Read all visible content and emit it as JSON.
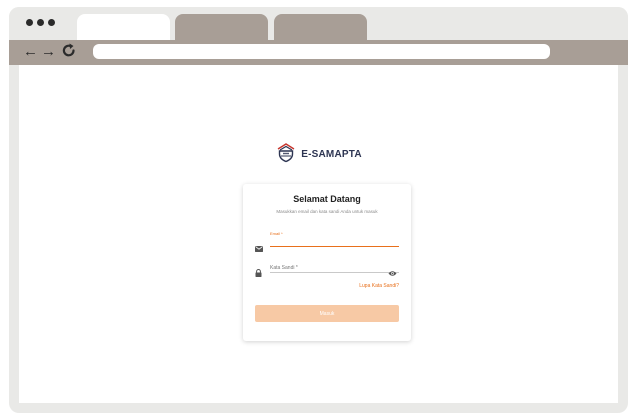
{
  "app": {
    "logo_text": "E-SAMAPTA"
  },
  "login": {
    "title": "Selamat Datang",
    "subtitle": "Masukkan email dan kata sandi Anda untuk masuk",
    "email_label": "Email *",
    "password_label": "Kata Sandi *",
    "forgot_link": "Lupa Kata Sandi?",
    "submit_label": "Masuk"
  },
  "colors": {
    "accent": "#e8701c",
    "button_disabled": "#f7c9a5",
    "logo": "#2d3552",
    "browser_chrome": "#a89e96"
  },
  "icons": {
    "email": "envelope-icon",
    "password": "lock-icon",
    "toggle_password": "eye-icon",
    "back": "arrow-left-icon",
    "forward": "arrow-right-icon",
    "reload": "reload-icon"
  }
}
